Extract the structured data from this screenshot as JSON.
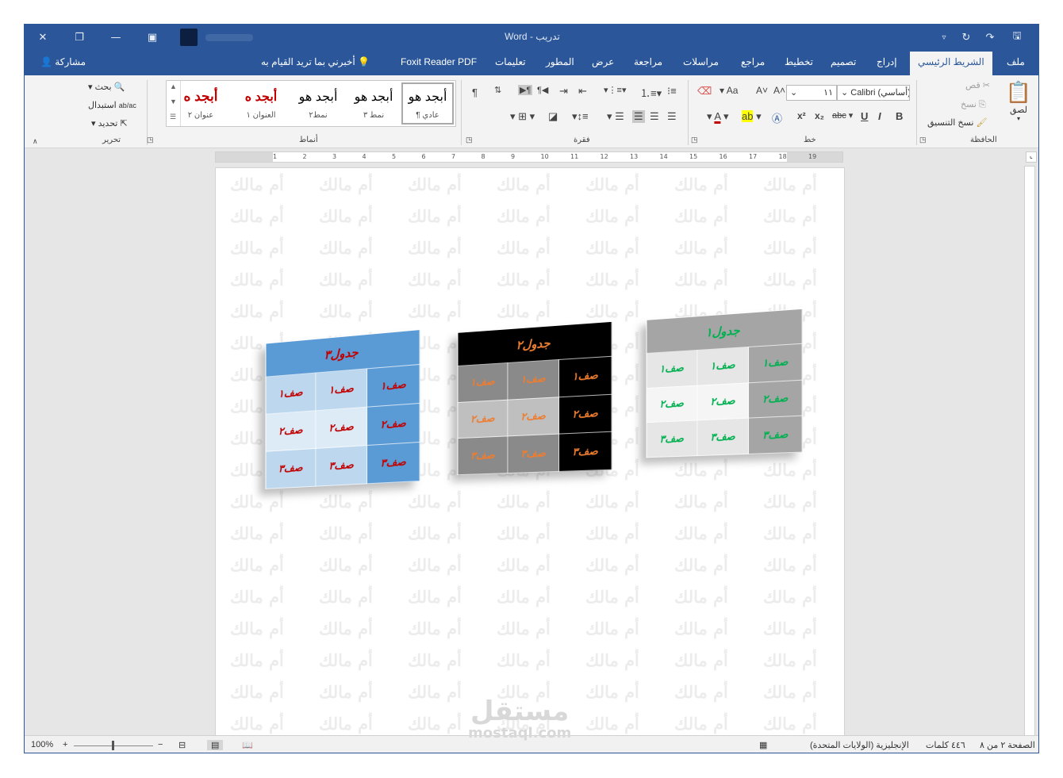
{
  "titlebar": {
    "title": "Word  -  تدريب"
  },
  "tabs": [
    "ملف",
    "الشريط الرئيسي",
    "إدراج",
    "تصميم",
    "تخطيط",
    "مراجع",
    "مراسلات",
    "مراجعة",
    "عرض",
    "المطور",
    "تعليمات",
    "Foxit Reader PDF"
  ],
  "tell_me": "أخبرني بما تريد القيام به",
  "share": "مشاركة",
  "ribbon": {
    "clipboard": {
      "label": "الحافظة",
      "paste": "لصق",
      "cut": "قص",
      "copy": "نسخ",
      "format_painter": "نسخ التنسيق"
    },
    "font": {
      "label": "خط",
      "font_name": "Calibri (أساسي)",
      "font_size": "١١"
    },
    "paragraph": {
      "label": "فقرة"
    },
    "styles": {
      "label": "أنماط",
      "items": [
        {
          "preview": "أبجد هو",
          "name": "¶ عادي",
          "color": "#000000"
        },
        {
          "preview": "أبجد هو",
          "name": "نمط ٣",
          "color": "#000000"
        },
        {
          "preview": "أبجد هو",
          "name": "نمط٢",
          "color": "#000000"
        },
        {
          "preview": "أبجد ه",
          "name": "العنوان ١",
          "color": "#c00000"
        },
        {
          "preview": "أبجد ه",
          "name": "عنوان ٢",
          "color": "#c00000"
        }
      ]
    },
    "editing": {
      "label": "تحرير",
      "find": "بحث",
      "replace": "استبدال",
      "select": "تحديد"
    }
  },
  "watermark": "أم مالك",
  "tables": [
    {
      "title": "جدول٣",
      "cells": [
        [
          "صف١",
          "صف١",
          "صف١"
        ],
        [
          "صف٢",
          "صف٢",
          "صف٢"
        ],
        [
          "صف٣",
          "صف٣",
          "صف٣"
        ]
      ],
      "head_bg": "#5b9bd5",
      "head_color": "#c00000"
    },
    {
      "title": "جدول٢",
      "cells": [
        [
          "صف١",
          "صف١",
          "صف١"
        ],
        [
          "صف٢",
          "صف٢",
          "صف٢"
        ],
        [
          "صف٣",
          "صف٣",
          "صف٣"
        ]
      ],
      "head_bg": "#000000",
      "head_color": "#ed7d31"
    },
    {
      "title": "جدول١",
      "cells": [
        [
          "صف١",
          "صف١",
          "صف١"
        ],
        [
          "صف٢",
          "صف٢",
          "صف٢"
        ],
        [
          "صف٣",
          "صف٣",
          "صف٣"
        ]
      ],
      "head_bg": "#a5a5a5",
      "head_color": "#00b050"
    }
  ],
  "status": {
    "page": "الصفحة ٢ من ٨",
    "words": "٤٤٦ كلمات",
    "language": "الإنجليزية (الولايات المتحدة)",
    "zoom": "100%"
  },
  "brand": {
    "arabic": "مستقل",
    "latin": "mostaql.com"
  }
}
